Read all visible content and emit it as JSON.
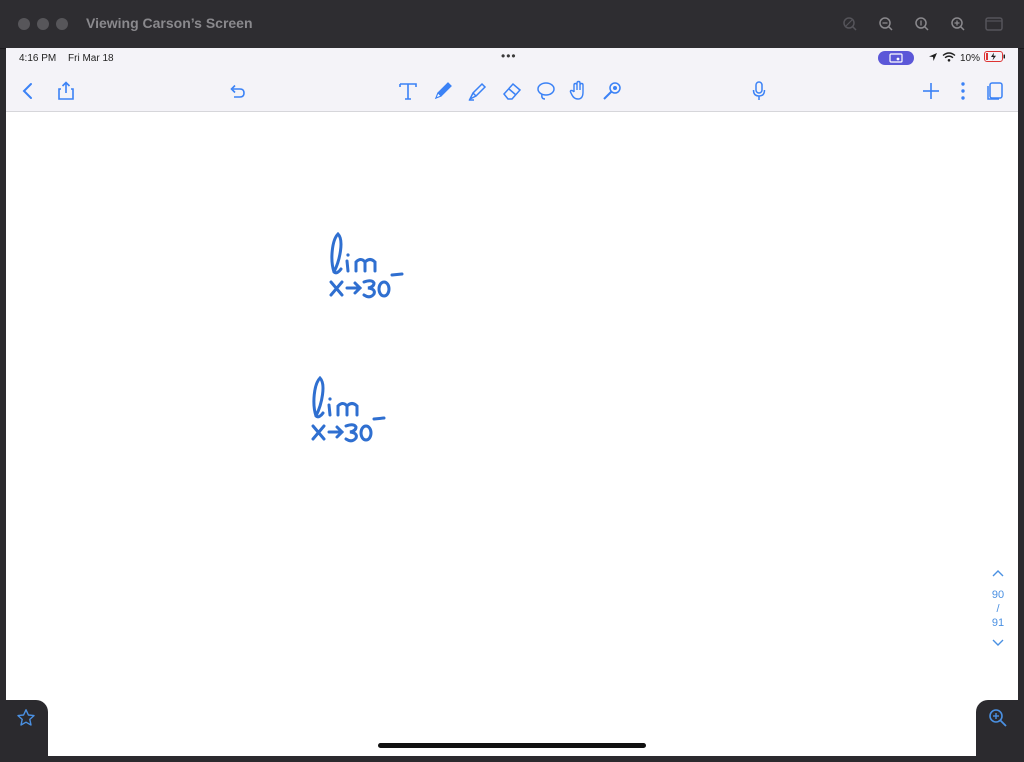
{
  "window": {
    "title": "Viewing Carson’s Screen"
  },
  "status_bar": {
    "time": "4:16 PM",
    "date": "Fri Mar 18",
    "battery": "10%",
    "multitask_dots": "•••"
  },
  "toolbar": {
    "left": [
      "back-icon",
      "share-icon",
      "undo-icon"
    ],
    "tools": [
      "text-tool-icon",
      "pen-tool-icon",
      "highlighter-tool-icon",
      "eraser-tool-icon",
      "lasso-tool-icon",
      "hand-tool-icon",
      "pointer-tool-icon"
    ],
    "center": [
      "microphone-icon"
    ],
    "right": [
      "add-page-icon",
      "more-icon",
      "pages-icon"
    ]
  },
  "notes": {
    "handwriting_1": {
      "line1": "lim",
      "line2": "x→30⁻"
    },
    "handwriting_2": {
      "line1": "lim",
      "line2": "x→30⁻"
    },
    "ink_color": "#2f6fd0"
  },
  "page_nav": {
    "current": "90",
    "separator": "/",
    "total": "91"
  },
  "colors": {
    "accent": "#4a90e2",
    "toolbar_bg": "#f4f3f8",
    "mac_bar_bg": "#2e2d31",
    "share_pill": "#5b57d8"
  }
}
